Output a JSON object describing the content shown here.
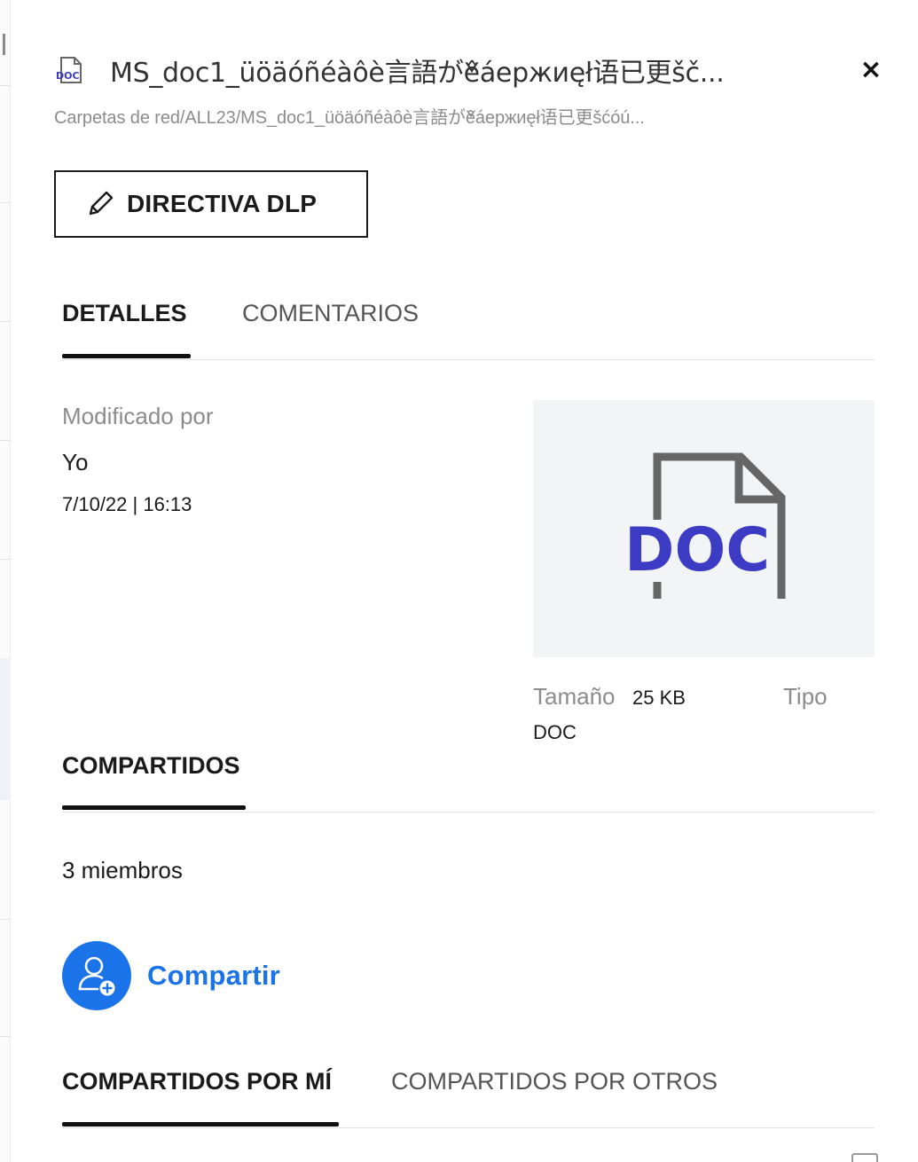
{
  "header": {
    "file_icon_label": "DOC",
    "title": "MS_doc1_üöäóñéàôè言語が̌êáержиęł语已更šč...",
    "close_glyph": "×",
    "path": "Carpetas de red/ALL23/MS_doc1_üöäóñéàôè言語が̌êáержиęł语已更šćóú..."
  },
  "actions": {
    "dlp_label": "DIRECTIVA DLP"
  },
  "tabs": [
    {
      "label": "DETALLES",
      "active": true
    },
    {
      "label": "COMENTARIOS",
      "active": false
    }
  ],
  "details": {
    "modified_by_label": "Modificado por",
    "modified_by_value": "Yo",
    "modified_date": "7/10/22 | 16:13",
    "preview_label": "DOC",
    "size_label": "Tamaño",
    "size_value": "25 KB",
    "type_label": "Tipo",
    "type_value": "DOC"
  },
  "shares": {
    "section_label": "COMPARTIDOS",
    "members": "3 miembros",
    "share_button_label": "Compartir",
    "tabs": [
      {
        "label": "COMPARTIDOS POR MÍ",
        "active": true
      },
      {
        "label": "COMPARTIDOS POR OTROS",
        "active": false
      }
    ]
  },
  "colors": {
    "accent_blue": "#1a73e8",
    "doc_purple": "#3b3bc4",
    "icon_gray": "#666666",
    "preview_bg": "#f3f4f6"
  },
  "icons": {
    "file": "doc-file-icon",
    "close": "close-icon",
    "edit": "pencil-icon",
    "share": "add-user-icon"
  }
}
